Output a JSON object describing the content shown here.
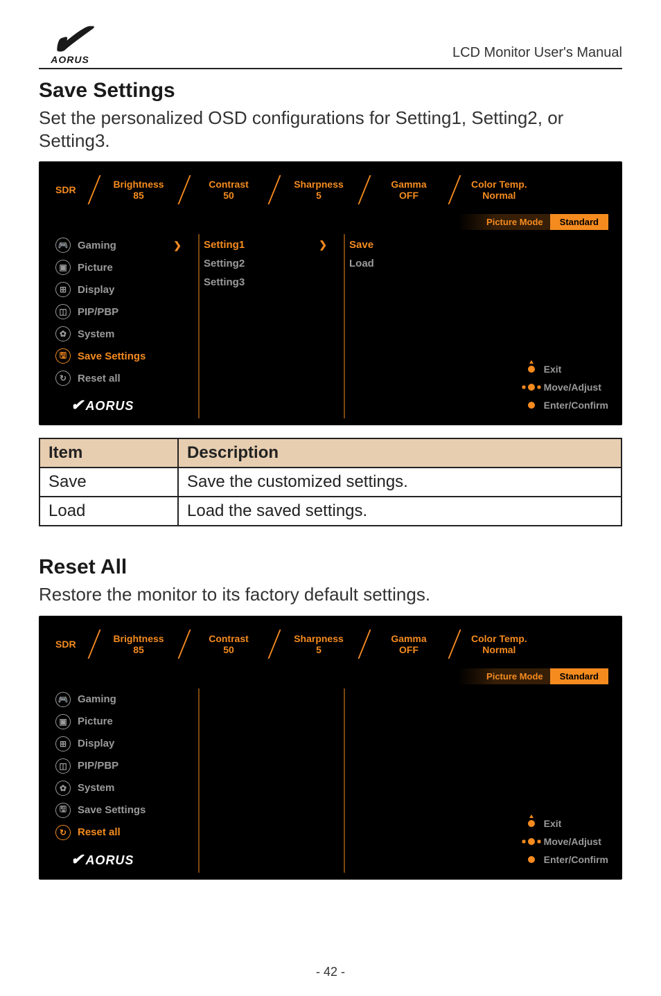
{
  "doc_header": "LCD Monitor User's Manual",
  "logo_text": "AORUS",
  "sections": {
    "save_settings": {
      "heading": "Save Settings",
      "intro": "Set the personalized OSD configurations for Setting1, Setting2, or Setting3."
    },
    "reset_all": {
      "heading": "Reset All",
      "intro": "Restore the monitor to its factory default settings."
    }
  },
  "status_bar": {
    "sdr": "SDR",
    "items": [
      {
        "label": "Brightness",
        "value": "85"
      },
      {
        "label": "Contrast",
        "value": "50"
      },
      {
        "label": "Sharpness",
        "value": "5"
      },
      {
        "label": "Gamma",
        "value": "OFF"
      },
      {
        "label": "Color Temp.",
        "value": "Normal"
      }
    ]
  },
  "picture_mode": {
    "label": "Picture Mode",
    "value": "Standard"
  },
  "menu_icons": {
    "gaming": "gamepad-icon",
    "picture": "image-icon",
    "display": "display-icon",
    "pip": "pip-icon",
    "system": "gear-icon",
    "save": "save-icon",
    "reset": "reset-icon"
  },
  "menu_items": [
    {
      "key": "gaming",
      "label": "Gaming",
      "glyph": "🎮"
    },
    {
      "key": "picture",
      "label": "Picture",
      "glyph": "▣"
    },
    {
      "key": "display",
      "label": "Display",
      "glyph": "⊞"
    },
    {
      "key": "pip",
      "label": "PIP/PBP",
      "glyph": "◫"
    },
    {
      "key": "system",
      "label": "System",
      "glyph": "✿"
    },
    {
      "key": "save",
      "label": "Save Settings",
      "glyph": "🖫"
    },
    {
      "key": "reset",
      "label": "Reset all",
      "glyph": "↻"
    }
  ],
  "osd1_active": "save",
  "osd2_active": "reset",
  "settings_col": [
    "Setting1",
    "Setting2",
    "Setting3"
  ],
  "settings_active": "Setting1",
  "actions_col": [
    "Save",
    "Load"
  ],
  "actions_active": "Save",
  "hints": [
    {
      "key": "exit",
      "label": "Exit"
    },
    {
      "key": "move",
      "label": "Move/Adjust"
    },
    {
      "key": "enter",
      "label": "Enter/Confirm"
    }
  ],
  "desc_table": {
    "headers": [
      "Item",
      "Description"
    ],
    "rows": [
      {
        "item": "Save",
        "desc": "Save the customized settings."
      },
      {
        "item": "Load",
        "desc": "Load the saved settings."
      }
    ]
  },
  "page_number": "- 42 -"
}
